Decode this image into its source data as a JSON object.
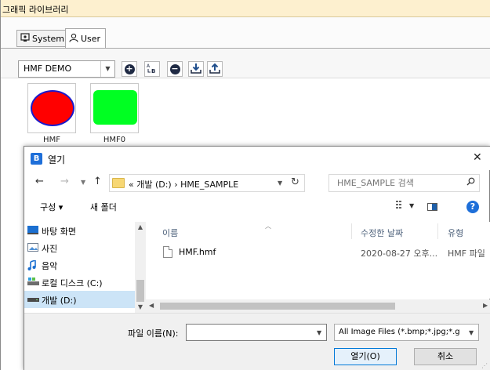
{
  "library": {
    "title": "그래픽 라이브러리",
    "tabs": [
      {
        "label": "System",
        "icon": "system-library-icon"
      },
      {
        "label": "User",
        "icon": "user-icon"
      }
    ],
    "project": "HMF DEMO",
    "toolbar_icons": [
      "add-icon",
      "rename-icon",
      "remove-icon",
      "import-icon",
      "export-icon"
    ],
    "items": [
      {
        "caption": "HMF",
        "shape": "ellipse",
        "fill": "#ff0000",
        "stroke": "#1a1acc"
      },
      {
        "caption": "HMF0",
        "shape": "rounded-rect",
        "fill": "#00ff22"
      }
    ]
  },
  "dialog": {
    "app_icon_letter": "B",
    "title": "열기",
    "close_glyph": "✕",
    "address": {
      "back": "←",
      "forward": "→",
      "up": "↑",
      "path": "« 개발 (D:) › HME_SAMPLE"
    },
    "search_placeholder": "HME_SAMPLE 검색",
    "commands": {
      "organize": "구성 ▾",
      "new_folder": "새 폴더"
    },
    "nav_pane": [
      {
        "label": "바탕 화면",
        "icon": "desktop-icon"
      },
      {
        "label": "사진",
        "icon": "pictures-icon"
      },
      {
        "label": "음악",
        "icon": "music-icon"
      },
      {
        "label": "로컬 디스크 (C:)",
        "icon": "local-disk-icon"
      },
      {
        "label": "개발 (D:)",
        "icon": "drive-icon",
        "selected": true
      }
    ],
    "columns": {
      "name": "이름",
      "date": "수정한 날짜",
      "type": "유형"
    },
    "files": [
      {
        "name": "HMF.hmf",
        "date": "2020-08-27 오후...",
        "type": "HMF 파일"
      }
    ],
    "footer": {
      "filename_label": "파일 이름(N):",
      "filename_value": "",
      "filter": "All Image Files (*.bmp;*.jpg;*.g",
      "open": "열기(O)",
      "cancel": "취소"
    }
  },
  "colors": {
    "title_bar": "#fdf0cf",
    "selection": "#cce4f7",
    "accent": "#0078d7"
  }
}
